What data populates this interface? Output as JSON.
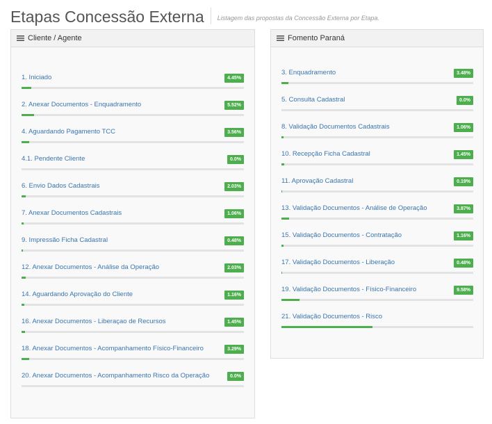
{
  "page": {
    "title": "Etapas Concessão Externa",
    "subtitle": "Listagem das propostas da Concessão Externa por Etapa."
  },
  "colors": {
    "accent": "#4cae4c",
    "link": "#3a75b0",
    "track": "#e3e3e3"
  },
  "left_panel": {
    "icon": "list-icon",
    "title": "Cliente / Agente",
    "items": [
      {
        "label": "1. Iniciado",
        "badge": "4.45%",
        "progress": 0.0445
      },
      {
        "label": "2. Anexar Documentos - Enquadramento",
        "badge": "5.52%",
        "progress": 0.0552
      },
      {
        "label": "4. Aguardando Pagamento TCC",
        "badge": "3.56%",
        "progress": 0.0356
      },
      {
        "label": "4.1. Pendente Cliente",
        "badge": "0.0%",
        "progress": 0
      },
      {
        "label": "6. Envio Dados Cadastrais",
        "badge": "2.03%",
        "progress": 0.0203
      },
      {
        "label": "7. Anexar Documentos Cadastrais",
        "badge": "1.06%",
        "progress": 0.0106
      },
      {
        "label": "9. Impressão Ficha Cadastral",
        "badge": "0.48%",
        "progress": 0.0048
      },
      {
        "label": "12. Anexar Documentos - Análise da Operação",
        "badge": "2.03%",
        "progress": 0.0203
      },
      {
        "label": "14. Aguardando Aprovação do Cliente",
        "badge": "1.16%",
        "progress": 0.0116
      },
      {
        "label": "16. Anexar Documentos - Liberaçao de Recursos",
        "badge": "1.45%",
        "progress": 0.0145
      },
      {
        "label": "18. Anexar Documentos - Acompanhamento Físico-Financeiro",
        "badge": "3.29%",
        "progress": 0.0329
      },
      {
        "label": "20. Anexar Documentos - Acompanhamento Risco da Operação",
        "badge": "0.0%",
        "progress": 0
      }
    ]
  },
  "right_panel": {
    "icon": "list-icon",
    "title": "Fomento Paraná",
    "items": [
      {
        "label": "3. Enquadramento",
        "badge": "3.48%",
        "progress": 0.0348
      },
      {
        "label": "5. Consulta Cadastral",
        "badge": "0.0%",
        "progress": 0
      },
      {
        "label": "8. Validação Documentos Cadastrais",
        "badge": "1.06%",
        "progress": 0.0106
      },
      {
        "label": "10. Recepção Ficha Cadastral",
        "badge": "1.45%",
        "progress": 0.0145
      },
      {
        "label": "11. Aprovação Cadastral",
        "badge": "0.19%",
        "progress": 0.0019
      },
      {
        "label": "13. Validação Documentos - Análise de Operação",
        "badge": "3.87%",
        "progress": 0.0387
      },
      {
        "label": "15. Validação Documentos - Contratação",
        "badge": "1.16%",
        "progress": 0.0116
      },
      {
        "label": "17. Validação Documentos - Liberação",
        "badge": "0.48%",
        "progress": 0.0048
      },
      {
        "label": "19. Validação Documentos - Físico-Financeiro",
        "badge": "9.58%",
        "progress": 0.0958
      },
      {
        "label": "21. Validação Documentos - Risco",
        "badge": "",
        "progress": 0.4739
      }
    ]
  }
}
